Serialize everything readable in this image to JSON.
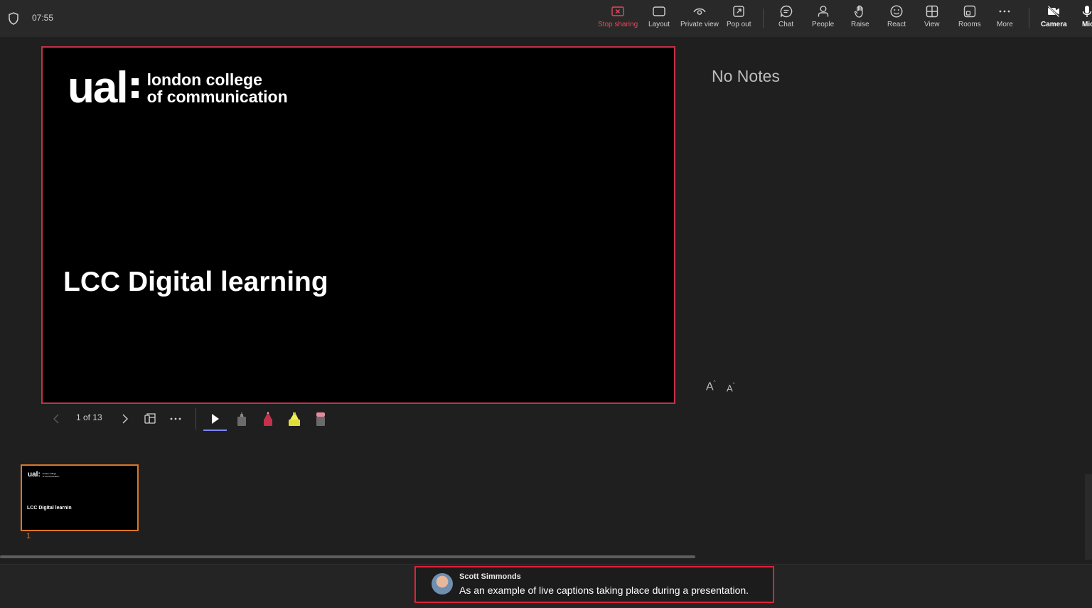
{
  "status": {
    "time": "07:55"
  },
  "toolbar": {
    "stop_sharing": "Stop sharing",
    "layout": "Layout",
    "private_view": "Private view",
    "pop_out": "Pop out",
    "chat": "Chat",
    "people": "People",
    "raise": "Raise",
    "react": "React",
    "view": "View",
    "rooms": "Rooms",
    "more": "More",
    "camera": "Camera",
    "mic": "Mic"
  },
  "slide": {
    "logo_ual": "ual",
    "logo_line1": "london college",
    "logo_line2": "of communication",
    "title": "LCC Digital learning"
  },
  "slide_controls": {
    "page_count": "1 of 13"
  },
  "notes": {
    "empty_text": "No Notes",
    "increase_font": "A",
    "decrease_font": "A"
  },
  "thumbnails": [
    {
      "number": "1",
      "title": "LCC Digital learnin",
      "logo_ual": "ual",
      "logo_line1": "london college",
      "logo_line2": "of communication"
    }
  ],
  "caption": {
    "speaker": "Scott Simmonds",
    "text": "As an example of live captions taking place during a presentation."
  },
  "colors": {
    "accent_red": "#c4314b",
    "thumb_border": "#d8772a",
    "pointer_underline": "#7f85f5"
  }
}
